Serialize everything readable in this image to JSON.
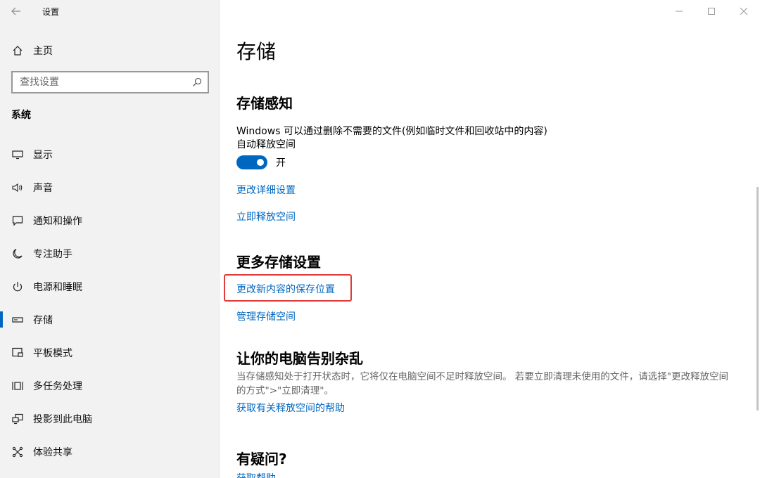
{
  "window": {
    "title": "设置",
    "controls": {
      "minimize": "—",
      "maximize": "☐",
      "close": "✕"
    }
  },
  "sidebar": {
    "home_label": "主页",
    "search_placeholder": "查找设置",
    "section_label": "系统",
    "items": [
      {
        "label": "显示",
        "icon": "display-icon"
      },
      {
        "label": "声音",
        "icon": "speaker-icon"
      },
      {
        "label": "通知和操作",
        "icon": "notification-icon"
      },
      {
        "label": "专注助手",
        "icon": "moon-icon"
      },
      {
        "label": "电源和睡眠",
        "icon": "power-icon"
      },
      {
        "label": "存储",
        "icon": "storage-icon",
        "active": true
      },
      {
        "label": "平板模式",
        "icon": "tablet-icon"
      },
      {
        "label": "多任务处理",
        "icon": "multitask-icon"
      },
      {
        "label": "投影到此电脑",
        "icon": "project-icon"
      },
      {
        "label": "体验共享",
        "icon": "share-icon"
      }
    ]
  },
  "main": {
    "page_title": "存储",
    "storage_sense": {
      "heading": "存储感知",
      "description": "Windows 可以通过删除不需要的文件(例如临时文件和回收站中的内容)",
      "subtext": "自动释放空间",
      "toggle_state": "开",
      "toggle_on": true,
      "link_change": "更改详细设置",
      "link_free_now": "立即释放空间"
    },
    "more_settings": {
      "heading": "更多存储设置",
      "link_save_location": "更改新内容的保存位置",
      "link_manage": "管理存储空间"
    },
    "declutter": {
      "heading": "让你的电脑告别杂乱",
      "description_line1": "当存储感知处于打开状态时，它将仅在电脑空间不足时释放空间。 若要立即清理未使用的文件，请选择\"更改释放空间",
      "description_line2": "的方式\">\"立即清理\"。",
      "link_help": "获取有关释放空间的帮助"
    },
    "faq": {
      "heading": "有疑问?",
      "link_help": "获取帮助"
    }
  },
  "colors": {
    "accent": "#0067c0",
    "highlight": "#e03a3a",
    "sidebar_bg": "#f2f2f2"
  }
}
